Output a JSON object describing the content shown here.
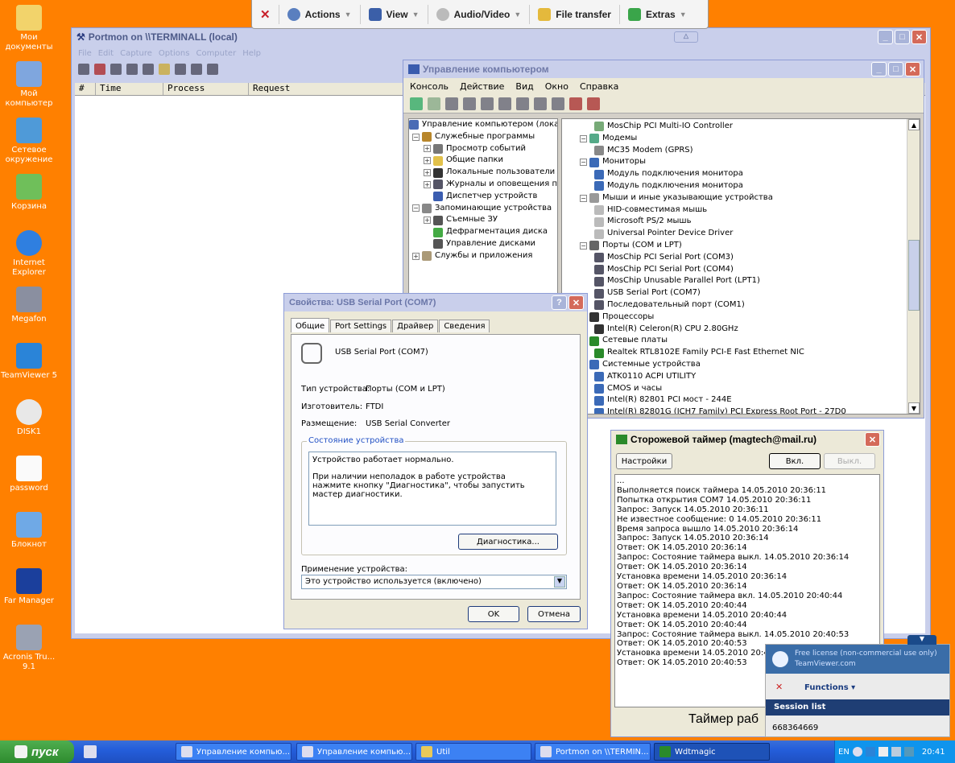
{
  "desktop": {
    "icons": [
      {
        "label": "Мои документы"
      },
      {
        "label": "Мой компьютер"
      },
      {
        "label": "Сетевое окружение"
      },
      {
        "label": "Корзина"
      },
      {
        "label": "Internet Explorer"
      },
      {
        "label": "Megafon"
      },
      {
        "label": "TeamViewer 5"
      },
      {
        "label": "DISK1"
      },
      {
        "label": "password"
      },
      {
        "label": "Блокнот"
      },
      {
        "label": "Far Manager"
      },
      {
        "label": "Acronis Tru... 9.1"
      }
    ]
  },
  "tvbar": {
    "close": "✕",
    "actions": "Actions",
    "view": "View",
    "audio": "Audio/Video",
    "file": "File transfer",
    "extras": "Extras"
  },
  "portmon": {
    "title": "Portmon on \\\\TERMINALL (local)",
    "menu": [
      "File",
      "Edit",
      "Capture",
      "Options",
      "Computer",
      "Help"
    ],
    "columns": [
      "#",
      "Time",
      "Process",
      "Request"
    ]
  },
  "cm": {
    "title": "Управление компьютером",
    "menu": [
      "Консоль",
      "Действие",
      "Вид",
      "Окно",
      "Справка"
    ],
    "tree": [
      "Управление компьютером (локаль",
      "Служебные программы",
      "Просмотр событий",
      "Общие папки",
      "Локальные пользователи и",
      "Журналы и оповещения пр",
      "Диспетчер устройств",
      "Запоминающие устройства",
      "Съемные ЗУ",
      "Дефрагментация диска",
      "Управление дисками",
      "Службы и приложения"
    ],
    "devices": [
      "MosChip PCI Multi-IO Controller",
      "Модемы",
      "MC35 Modem (GPRS)",
      "Мониторы",
      "Модуль подключения монитора",
      "Модуль подключения монитора",
      "Мыши и иные указывающие устройства",
      "HID-совместимая мышь",
      "Microsoft PS/2 мышь",
      "Universal Pointer Device Driver",
      "Порты (COM и LPT)",
      "MosChip PCI Serial Port (COM3)",
      "MosChip PCI Serial Port (COM4)",
      "MosChip Unusable Parallel Port (LPT1)",
      "USB Serial Port (COM7)",
      "Последовательный порт (COM1)",
      "Процессоры",
      "Intel(R) Celeron(R) CPU 2.80GHz",
      "Сетевые платы",
      "Realtek RTL8102E Family PCI-E Fast Ethernet NIC",
      "Системные устройства",
      "ATK0110 ACPI UTILITY",
      "CMOS и часы",
      "Intel(R) 82801 PCI мост - 244E",
      "Intel(R) 82801G (ICH7 Family) PCI Express Root Port - 27D0"
    ]
  },
  "props": {
    "title": "Свойства: USB Serial Port (COM7)",
    "tabs": [
      "Общие",
      "Port Settings",
      "Драйвер",
      "Сведения"
    ],
    "device_name": "USB Serial Port (COM7)",
    "type_label": "Тип устройства:",
    "type_value": "Порты (COM и LPT)",
    "maker_label": "Изготовитель:",
    "maker_value": "FTDI",
    "place_label": "Размещение:",
    "place_value": "USB Serial Converter",
    "status_group": "Состояние устройства",
    "status_line1": "Устройство работает нормально.",
    "status_line2": "При наличии неполадок в работе устройства нажмите кнопку \"Диагностика\", чтобы запустить мастер диагностики.",
    "diag_button": "Диагностика...",
    "usage_label": "Применение устройства:",
    "usage_value": "Это устройство используется (включено)",
    "ok": "OK",
    "cancel": "Отмена"
  },
  "wd": {
    "title": "Сторожевой таймер (magtech@mail.ru)",
    "settings": "Настройки",
    "on": "Вкл.",
    "off": "Выкл.",
    "log": [
      "...",
      "Выполняется поиск таймера 14.05.2010 20:36:11",
      "Попытка открытия COM7 14.05.2010 20:36:11",
      "Запрос: Запуск 14.05.2010 20:36:11",
      "Не известное сообщение: 0 14.05.2010 20:36:11",
      "Время запроса вышло 14.05.2010 20:36:14",
      "Запрос: Запуск 14.05.2010 20:36:14",
      "Ответ: ОК 14.05.2010 20:36:14",
      "Запрос: Состояние таймера выкл. 14.05.2010 20:36:14",
      "Ответ: ОК 14.05.2010 20:36:14",
      "Установка времени 14.05.2010 20:36:14",
      "Ответ: ОК 14.05.2010 20:36:14",
      "Запрос: Состояние таймера вкл. 14.05.2010 20:40:44",
      "Ответ: ОК 14.05.2010 20:40:44",
      "Установка времени 14.05.2010 20:40:44",
      "Ответ: ОК 14.05.2010 20:40:44",
      "Запрос: Состояние таймера выкл. 14.05.2010 20:40:53",
      "Ответ: ОК 14.05.2010 20:40:53",
      "Установка времени 14.05.2010 20:40:53",
      "Ответ: ОК 14.05.2010 20:40:53"
    ],
    "status": "Таймер раб"
  },
  "tvpanel": {
    "license": "Free license (non-commercial use only)",
    "brand": "TeamViewer.com",
    "functions": "Functions",
    "session": "Session list",
    "id": "668364669"
  },
  "taskbar": {
    "start": "пуск",
    "tasks": [
      "Управление компью...",
      "Управление компью...",
      "Util",
      "Portmon on \\\\TERMIN...",
      "Wdtmagic"
    ],
    "lang": "EN",
    "clock": "20:41"
  }
}
